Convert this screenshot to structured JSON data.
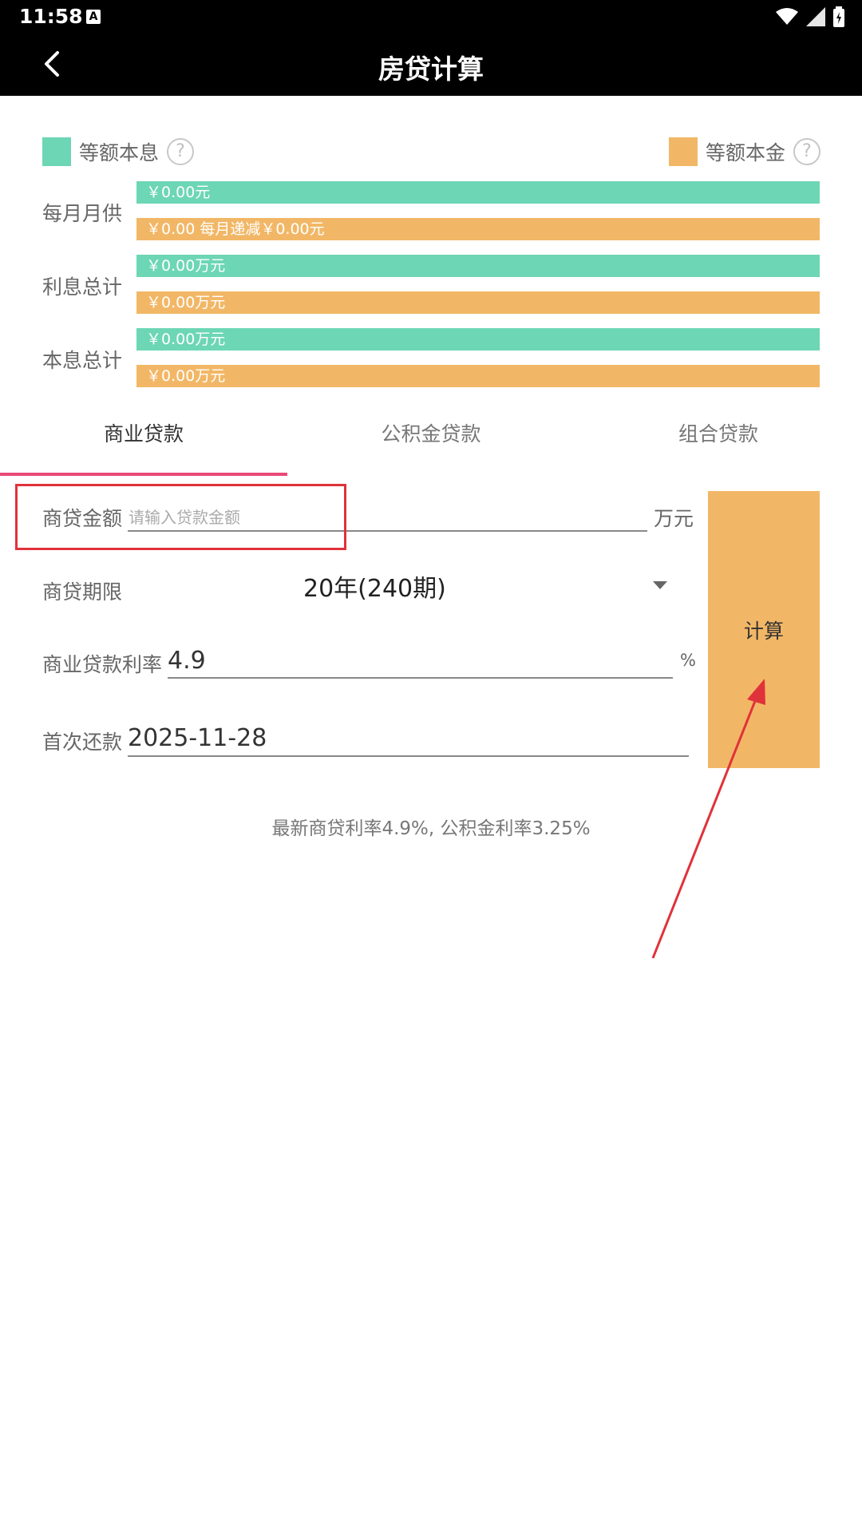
{
  "status_bar": {
    "time": "11:58",
    "a_icon": "A"
  },
  "app_bar": {
    "title": "房贷计算",
    "back_icon": "back-arrow-icon"
  },
  "legend": {
    "equal_payment": {
      "label": "等额本息",
      "color": "#6dd6b4"
    },
    "equal_principal": {
      "label": "等额本金",
      "color": "#f2b766"
    },
    "help_glyph": "?"
  },
  "results": {
    "monthly": {
      "label": "每月月供",
      "equal_payment": "￥0.00元",
      "equal_principal": "￥0.00 每月递减￥0.00元"
    },
    "interest_total": {
      "label": "利息总计",
      "equal_payment": "￥0.00万元",
      "equal_principal": "￥0.00万元"
    },
    "total": {
      "label": "本息总计",
      "equal_payment": "￥0.00万元",
      "equal_principal": "￥0.00万元"
    }
  },
  "tabs": [
    {
      "label": "商业贷款",
      "active": true
    },
    {
      "label": "公积金贷款",
      "active": false
    },
    {
      "label": "组合贷款",
      "active": false
    }
  ],
  "form": {
    "amount": {
      "label": "商贷金额",
      "placeholder": "请输入贷款金额",
      "value": "",
      "unit": "万元"
    },
    "term": {
      "label": "商贷期限",
      "value": "20年(240期)"
    },
    "rate": {
      "label": "商业贷款利率",
      "value": "4.9",
      "unit": "%"
    },
    "first_payment": {
      "label": "首次还款",
      "value": "2025-11-28"
    }
  },
  "calculate_button": "计算",
  "note": "最新商贷利率4.9%, 公积金利率3.25%"
}
